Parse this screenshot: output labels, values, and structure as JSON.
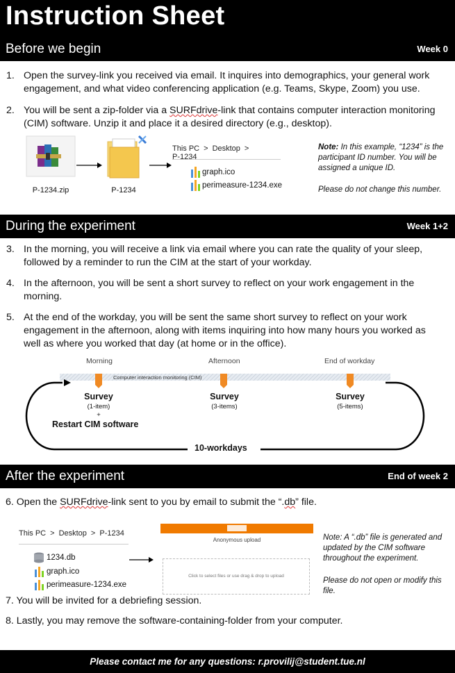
{
  "title": "Instruction Sheet",
  "sections": {
    "before": {
      "title": "Before we begin",
      "week": "Week 0"
    },
    "during": {
      "title": "During the experiment",
      "week": "Week 1+2"
    },
    "after": {
      "title": "After the experiment",
      "week": "End of week 2"
    }
  },
  "before_items": [
    {
      "num": "1.",
      "text_a": "Open the survey-link you received via email. It inquires into demographics, your general work",
      "text_b": "engagement, and what video conferencing application (e.g. Teams, Skype, Zoom) you use."
    },
    {
      "num": "2.",
      "text_a_pre": "You will be sent a zip-folder via a ",
      "text_a_link": "SURFdrive",
      "text_a_post": "-link that contains computer interaction monitoring",
      "text_b": "(CIM) software. Unzip it and place it a desired directory (e.g., desktop)."
    }
  ],
  "figure1": {
    "zip_label": "P-1234.zip",
    "folder_label": "P-1234",
    "path": [
      "This PC",
      ">",
      "Desktop",
      ">",
      "P-1234"
    ],
    "files": [
      "graph.ico",
      "perimeasure-1234.exe"
    ],
    "note_bold": "Note:",
    "note_text": " In this example, “1234” is the participant ID number. You will be assigned a unique ID.",
    "note_text2": "Please do not change this number."
  },
  "during_items": [
    {
      "num": "3.",
      "text_a": "In the morning, you will receive a link via email where you can rate the quality of your sleep,",
      "text_b": "followed by a reminder to run the CIM at the start of your workday."
    },
    {
      "num": "4.",
      "text_a": "In the afternoon, you will be sent a short survey to reflect on your work engagement in the",
      "text_b": "morning."
    },
    {
      "num": "5.",
      "text_a": "At the end of the workday, you will be sent the same short survey to reflect on your work",
      "text_b": "engagement in the afternoon, along with items inquiring into how many hours you worked as",
      "text_c": "well as where you worked that day (at home or in the office)."
    }
  ],
  "timeline": {
    "times": [
      "Morning",
      "Afternoon",
      "End of workday"
    ],
    "band_label": "Computer interaction monitoring (CIM)",
    "surveys": [
      {
        "label": "Survey",
        "sub": "(1-item)"
      },
      {
        "label": "Survey",
        "sub": "(3-items)"
      },
      {
        "label": "Survey",
        "sub": "(5-items)"
      }
    ],
    "plus": "+",
    "restart": "Restart CIM software",
    "workdays": "10-workdays",
    "colors": {
      "marker": "#f08a24",
      "band": "#d9e1ea"
    }
  },
  "after_items": {
    "item6_pre": "6. Open the ",
    "item6_link": "SURFdrive",
    "item6_mid": "-link sent to you by email to submit the “.",
    "item6_db": "db",
    "item6_post": "” file.",
    "item7": "7. You will be invited for a debriefing session.",
    "item8": "8. Lastly, you may remove the software-containing-folder from your computer."
  },
  "figure2": {
    "path": [
      "This PC",
      ">",
      "Desktop",
      ">",
      "P-1234"
    ],
    "files": [
      "1234.db",
      "graph.ico",
      "perimeasure-1234.exe"
    ],
    "upload_title": "Anonymous upload",
    "upload_drop": "Click to select files or use drag & drop to upload",
    "note_a": "Note: A “.db” file is  generated and updated by the CIM software throughout the experiment.",
    "note_b": "Please do not open or modify this file.",
    "accent": "#f07a00"
  },
  "footer": "Please contact me for any questions:  r.provilij@student.tue.nl"
}
